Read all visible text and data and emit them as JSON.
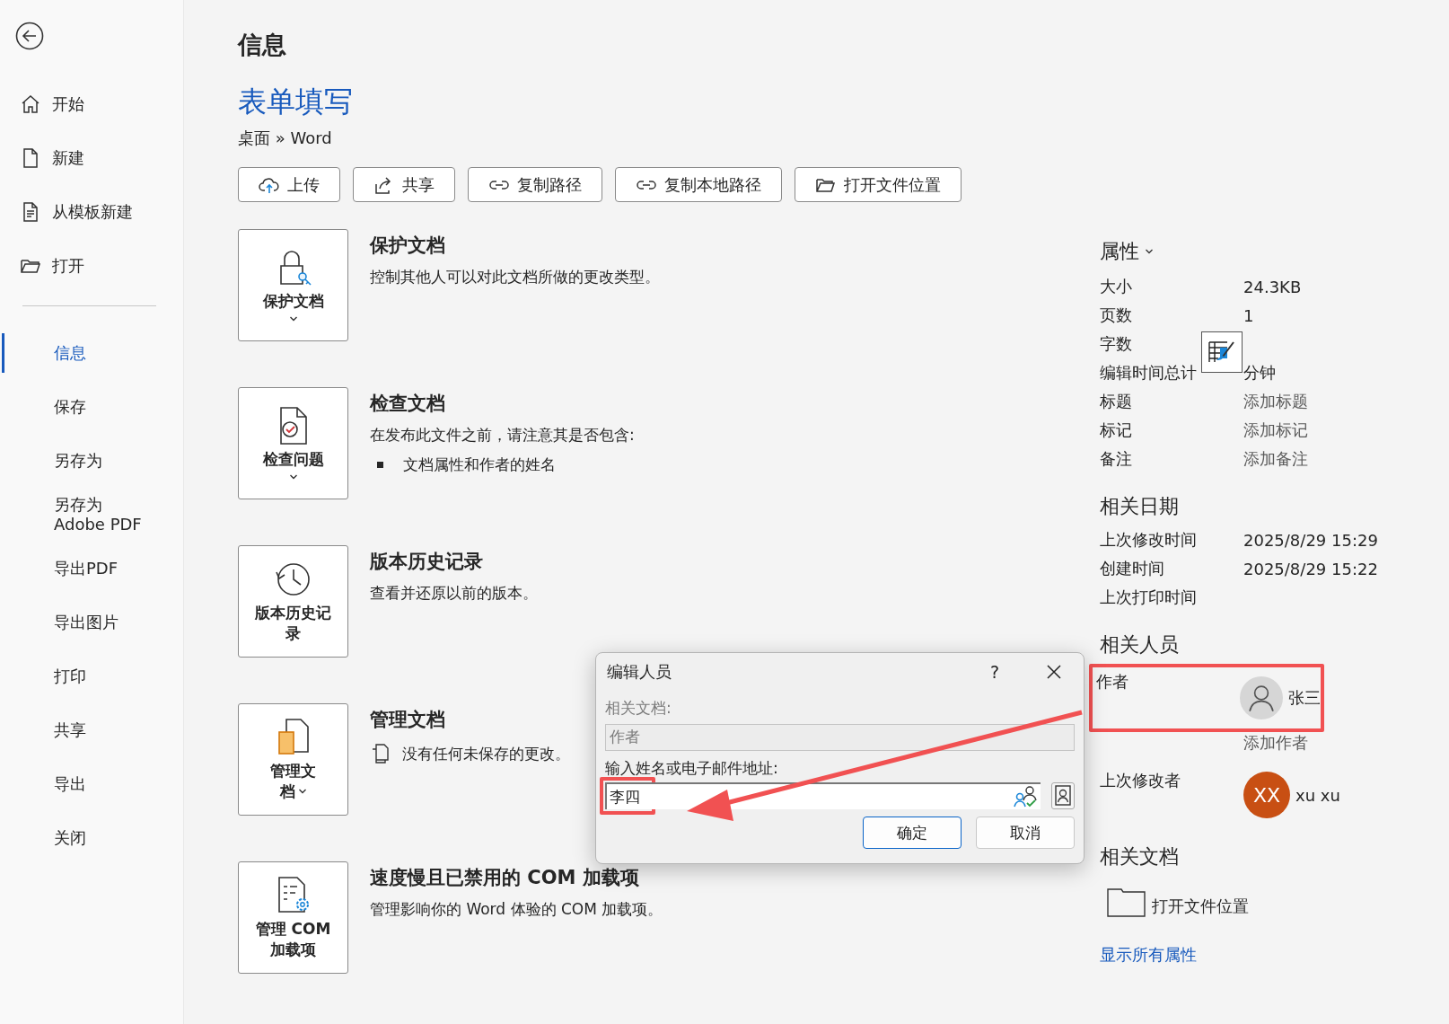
{
  "sidebar": {
    "items": [
      {
        "label": "开始",
        "selected": false
      },
      {
        "label": "新建",
        "selected": false
      },
      {
        "label": "从模板新建",
        "selected": false
      },
      {
        "label": "打开",
        "selected": false
      },
      {
        "kind": "divider"
      },
      {
        "label": "信息",
        "selected": true
      },
      {
        "label": "保存",
        "selected": false
      },
      {
        "label": "另存为",
        "selected": false
      },
      {
        "lines": [
          "另存为",
          "Adobe PDF"
        ],
        "selected": false
      },
      {
        "label": "导出PDF",
        "selected": false
      },
      {
        "label": "导出图片",
        "selected": false
      },
      {
        "label": "打印",
        "selected": false
      },
      {
        "label": "共享",
        "selected": false
      },
      {
        "label": "导出",
        "selected": false
      },
      {
        "label": "关闭",
        "selected": false
      }
    ]
  },
  "page_title": "信息",
  "document": {
    "title": "表单填写",
    "path": "桌面 » Word"
  },
  "actions": [
    {
      "label": "上传"
    },
    {
      "label": "共享"
    },
    {
      "label": "复制路径"
    },
    {
      "label": "复制本地路径"
    },
    {
      "label": "打开文件位置"
    }
  ],
  "sections": [
    {
      "button_lines": [
        "保护文档"
      ],
      "dropdown": true,
      "title": "保护文档",
      "description": "控制其他人可以对此文档所做的更改类型。"
    },
    {
      "button_lines": [
        "检查问题"
      ],
      "dropdown": true,
      "title": "检查文档",
      "description": "在发布此文件之前，请注意其是否包含:",
      "bullets": [
        "文档属性和作者的姓名"
      ]
    },
    {
      "button_lines": [
        "版本历史记",
        "录"
      ],
      "dropdown": false,
      "title": "版本历史记录",
      "description": "查看并还原以前的版本。"
    },
    {
      "button_lines": [
        "管理文",
        "档"
      ],
      "dropdown": true,
      "title": "管理文档",
      "note": "没有任何未保存的更改。"
    },
    {
      "button_lines": [
        "管理 COM",
        "加载项"
      ],
      "dropdown": false,
      "title": "速度慢且已禁用的 COM 加载项",
      "description": "管理影响你的 Word 体验的 COM 加载项。"
    }
  ],
  "properties": {
    "heading": "属性",
    "rows": [
      {
        "label": "大小",
        "value": "24.3KB",
        "kind": "value"
      },
      {
        "label": "页数",
        "value": "1",
        "kind": "value"
      },
      {
        "label": "字数"
      },
      {
        "label": "编辑时间总计",
        "value": "分钟",
        "kind": "value"
      },
      {
        "label": "标题",
        "value": "添加标题",
        "kind": "placeholder"
      },
      {
        "label": "标记",
        "value": "添加标记",
        "kind": "placeholder"
      },
      {
        "label": "备注",
        "value": "添加备注",
        "kind": "placeholder"
      }
    ]
  },
  "related_dates": {
    "heading": "相关日期",
    "rows": [
      {
        "label": "上次修改时间",
        "value": "2025/8/29 15:29"
      },
      {
        "label": "创建时间",
        "value": "2025/8/29 15:22"
      },
      {
        "label": "上次打印时间"
      }
    ]
  },
  "related_people": {
    "heading": "相关人员",
    "rows": [
      {
        "label": "作者",
        "name": "张三",
        "highlighted": true,
        "add_label": "添加作者"
      },
      {
        "label": "上次修改者",
        "name": "xu xu",
        "initials": "XX",
        "color": "#c84f13",
        "highlighted": false
      }
    ]
  },
  "related_documents": {
    "heading": "相关文档",
    "items": [
      {
        "label": "打开文件位置"
      }
    ]
  },
  "show_all_link": "显示所有属性",
  "dialog": {
    "title": "编辑人员",
    "help": "?",
    "related_label": "相关文档:",
    "related_value": "作者",
    "related_disabled": true,
    "input_label": "输入姓名或电子邮件地址:",
    "input_value": "李四",
    "input_highlighted": true,
    "buttons": [
      {
        "label": "确定",
        "default": true
      },
      {
        "label": "取消",
        "default": false
      }
    ]
  }
}
